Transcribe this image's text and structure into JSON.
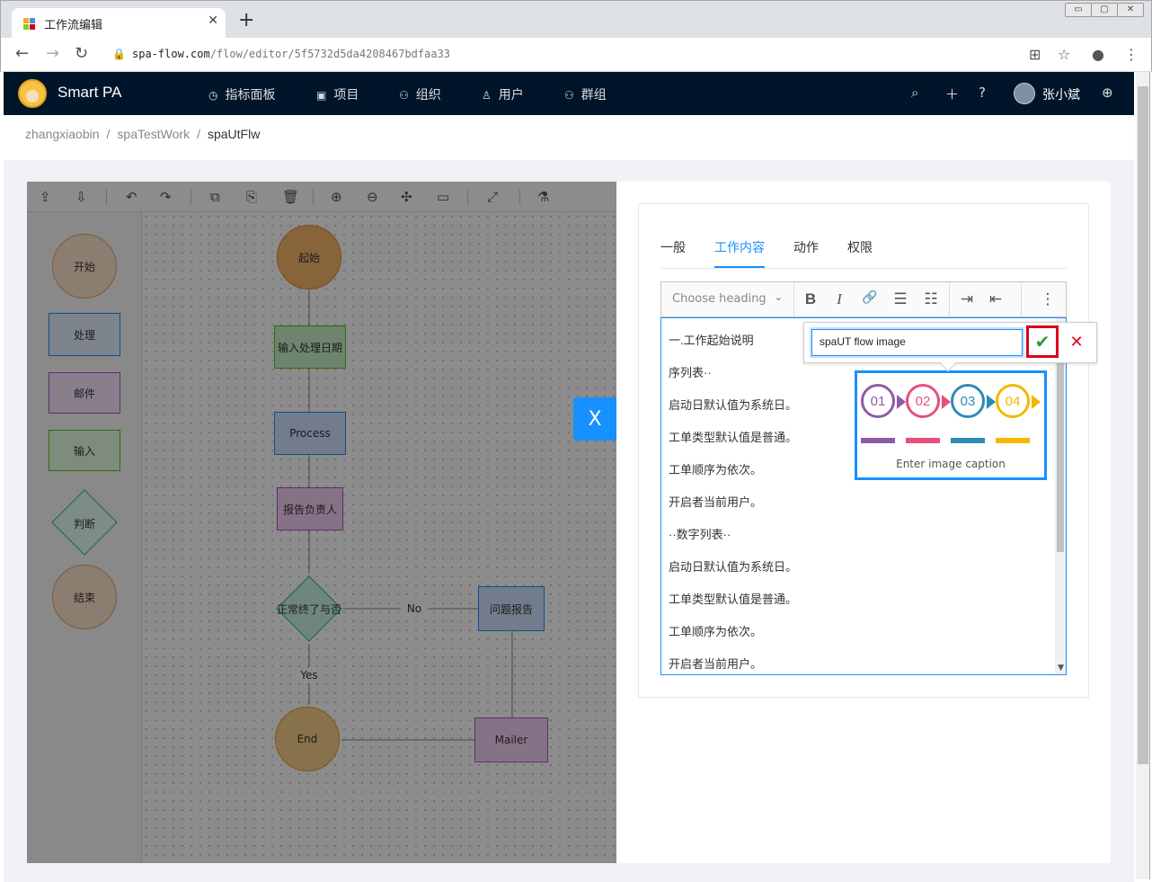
{
  "browser": {
    "tab_title": "工作流编辑",
    "tab_close": "✕",
    "new_tab": "+",
    "url_host": "spa-flow.com",
    "url_path": "/flow/editor/5f5732d5da4208467bdfaa33",
    "window_controls": [
      "▭",
      "▢",
      "✕"
    ]
  },
  "app": {
    "brand": "Smart PA",
    "menu": [
      {
        "icon": "◷",
        "label": "指标面板"
      },
      {
        "icon": "▣",
        "label": "项目"
      },
      {
        "icon": "⚇",
        "label": "组织"
      },
      {
        "icon": "♙",
        "label": "用户"
      },
      {
        "icon": "⚇",
        "label": "群组"
      }
    ],
    "user_name": "张小斌"
  },
  "breadcrumb": [
    "zhangxiaobin",
    "spaTestWork",
    "spaUtFlw"
  ],
  "flow": {
    "stencil": [
      "开始",
      "处理",
      "邮件",
      "输入",
      "判断",
      "结束"
    ],
    "nodes": {
      "start": "起始",
      "input_date": "输入处理日期",
      "process": "Process",
      "report": "报告负责人",
      "decision": "正常终了与否",
      "issue": "问题报告",
      "end": "End",
      "mailer": "Mailer"
    },
    "edges": {
      "no": "No",
      "yes": "Yes"
    }
  },
  "drawer": {
    "close_label": "X",
    "tabs": [
      "一般",
      "工作内容",
      "动作",
      "权限"
    ],
    "active_tab": "工作内容",
    "heading_placeholder": "Choose heading",
    "toolbar": {
      "bold": "B",
      "italic": "I",
      "link": "🔗",
      "bullet": "☰",
      "numbered": "☷",
      "indent": "⇥",
      "outdent": "⇤",
      "more": "⋮"
    },
    "lines": [
      "一.工作起始说明",
      "序列表··",
      "启动日默认值为系统日。",
      "工单类型默认值是普通。",
      "工单顺序为依次。",
      "开启者当前用户。",
      "··数字列表··",
      "启动日默认值为系统日。",
      "工单类型默认值是普通。",
      "工单顺序为依次。",
      "开启者当前用户。"
    ],
    "image_steps": [
      "01",
      "02",
      "03",
      "04"
    ],
    "image_caption_placeholder": "Enter image caption",
    "caption_value": "spaUT flow image",
    "save_icon": "✔",
    "cancel_icon": "✕"
  },
  "colors": {
    "header_bg": "#001529",
    "accent": "#1890ff",
    "save_highlight": "#d9001b",
    "step_colors": [
      "#8e5ba8",
      "#e6507a",
      "#2e8bb8",
      "#f2b800"
    ]
  }
}
